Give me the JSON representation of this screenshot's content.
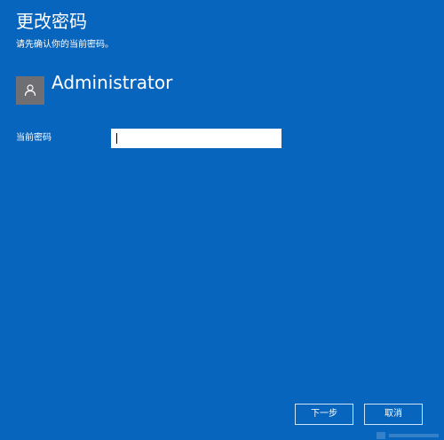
{
  "header": {
    "title": "更改密码",
    "subtitle": "请先确认你的当前密码。"
  },
  "account": {
    "name": "Administrator",
    "avatar_icon": "user-silhouette-icon"
  },
  "form": {
    "current_password_label": "当前密码",
    "current_password_value": "",
    "current_password_placeholder": ""
  },
  "buttons": {
    "next_label": "下一步",
    "cancel_label": "取消"
  },
  "colors": {
    "background": "#0865bd",
    "avatar_background": "#6f6f73",
    "button_border": "#cfe3f7"
  }
}
